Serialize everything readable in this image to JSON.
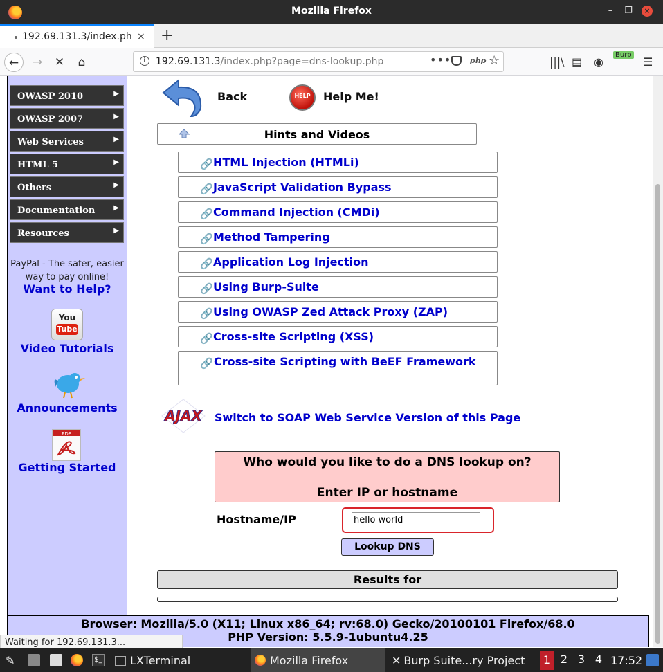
{
  "window": {
    "title": "Mozilla Firefox"
  },
  "tab": {
    "label": "192.69.131.3/index.php?p",
    "close": "×"
  },
  "newtab_symbol": "+",
  "address": {
    "host": "192.69.131.3",
    "path": "/index.php?page=dns-lookup.php",
    "dots": "•••",
    "php_badge": "php"
  },
  "burp_badge": "Burp",
  "sidebar": {
    "menu": [
      {
        "label": "OWASP 2010"
      },
      {
        "label": "OWASP 2007"
      },
      {
        "label": "Web Services"
      },
      {
        "label": "HTML 5"
      },
      {
        "label": "Others"
      },
      {
        "label": "Documentation"
      },
      {
        "label": "Resources"
      }
    ],
    "paypal_line1": "PayPal - The safer, easier",
    "paypal_line2": "way to pay online!",
    "want_help": "Want to Help?",
    "youtube_you": "You",
    "youtube_tube": "Tube",
    "video_tutorials": "Video Tutorials",
    "announcements": "Announcements",
    "pdf_badge": "PDF",
    "getting_started": "Getting Started"
  },
  "main": {
    "back_label": "Back",
    "help_icon_text": "HELP",
    "help_label": "Help Me!",
    "hints_label": "Hints and Videos",
    "hint_links": [
      "HTML Injection (HTMLi)",
      "JavaScript Validation Bypass",
      "Command Injection (CMDi)",
      "Method Tampering",
      "Application Log Injection",
      "Using Burp-Suite",
      "Using OWASP Zed Attack Proxy (ZAP)",
      "Cross-site Scripting (XSS)",
      "Cross-site Scripting with BeEF Framework"
    ],
    "ajax_logo": "AJAX",
    "soap_link": "Switch to SOAP Web Service Version of this Page",
    "dns_question": "Who would you like to do a DNS lookup on?",
    "dns_enter": "Enter IP or hostname",
    "hostname_label": "Hostname/IP",
    "hostname_value": "hello world",
    "lookup_button": "Lookup DNS",
    "results_label": "Results for"
  },
  "footer": {
    "browser_line": "Browser: Mozilla/5.0 (X11; Linux x86_64; rv:68.0) Gecko/20100101 Firefox/68.0",
    "php_line": "PHP Version: 5.5.9-1ubuntu4.25"
  },
  "status": "Waiting for 192.69.131.3...",
  "taskbar": {
    "tasks": [
      "LXTerminal",
      "Mozilla Firefox",
      "Burp Suite...ry Project"
    ],
    "workspaces": [
      "1",
      "2",
      "3",
      "4"
    ],
    "clock": "17:52"
  },
  "colors": {
    "link": "#0000cc",
    "sidebar_bg": "#ccccff",
    "dns_box_bg": "#ffcccc",
    "input_highlight": "#d9252b"
  }
}
